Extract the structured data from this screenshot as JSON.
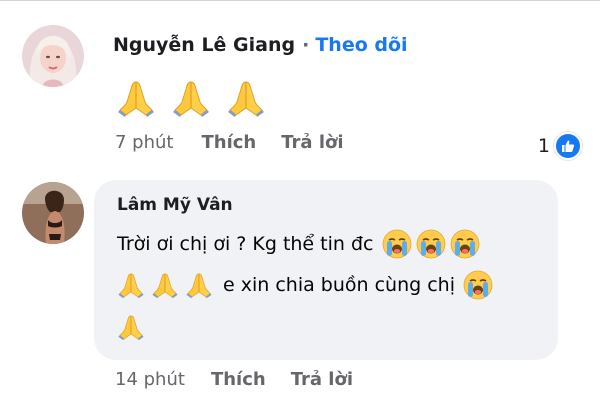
{
  "comments": [
    {
      "author": "Nguyễn Lê Giang",
      "separator": "·",
      "follow_label": "Theo dõi",
      "time": "7 phút",
      "like_label": "Thích",
      "reply_label": "Trả lời",
      "reaction_count": "1",
      "reaction_icon": "like-icon",
      "body_emoji": [
        "folded-hands-emoji",
        "folded-hands-emoji",
        "folded-hands-emoji"
      ]
    },
    {
      "author": "Lâm Mỹ Vân",
      "line1_text": "Trời ơi chị ơi ? Kg thể tin đc",
      "line1_emoji": [
        "loudly-crying-face-emoji",
        "loudly-crying-face-emoji",
        "loudly-crying-face-emoji"
      ],
      "line2_text": "e xin chia buồn cùng chị",
      "line2_lead_emoji": [
        "folded-hands-emoji",
        "folded-hands-emoji",
        "folded-hands-emoji"
      ],
      "line2_trail_emoji": "loudly-crying-face-emoji",
      "line3_emoji": "folded-hands-emoji",
      "time": "14 phút",
      "like_label": "Thích",
      "reply_label": "Trả lời"
    }
  ],
  "colors": {
    "link_blue": "#1877f2",
    "meta_gray": "#65676b",
    "bubble_bg": "#f0f2f5",
    "emoji_yellow": "#ffc83d"
  }
}
